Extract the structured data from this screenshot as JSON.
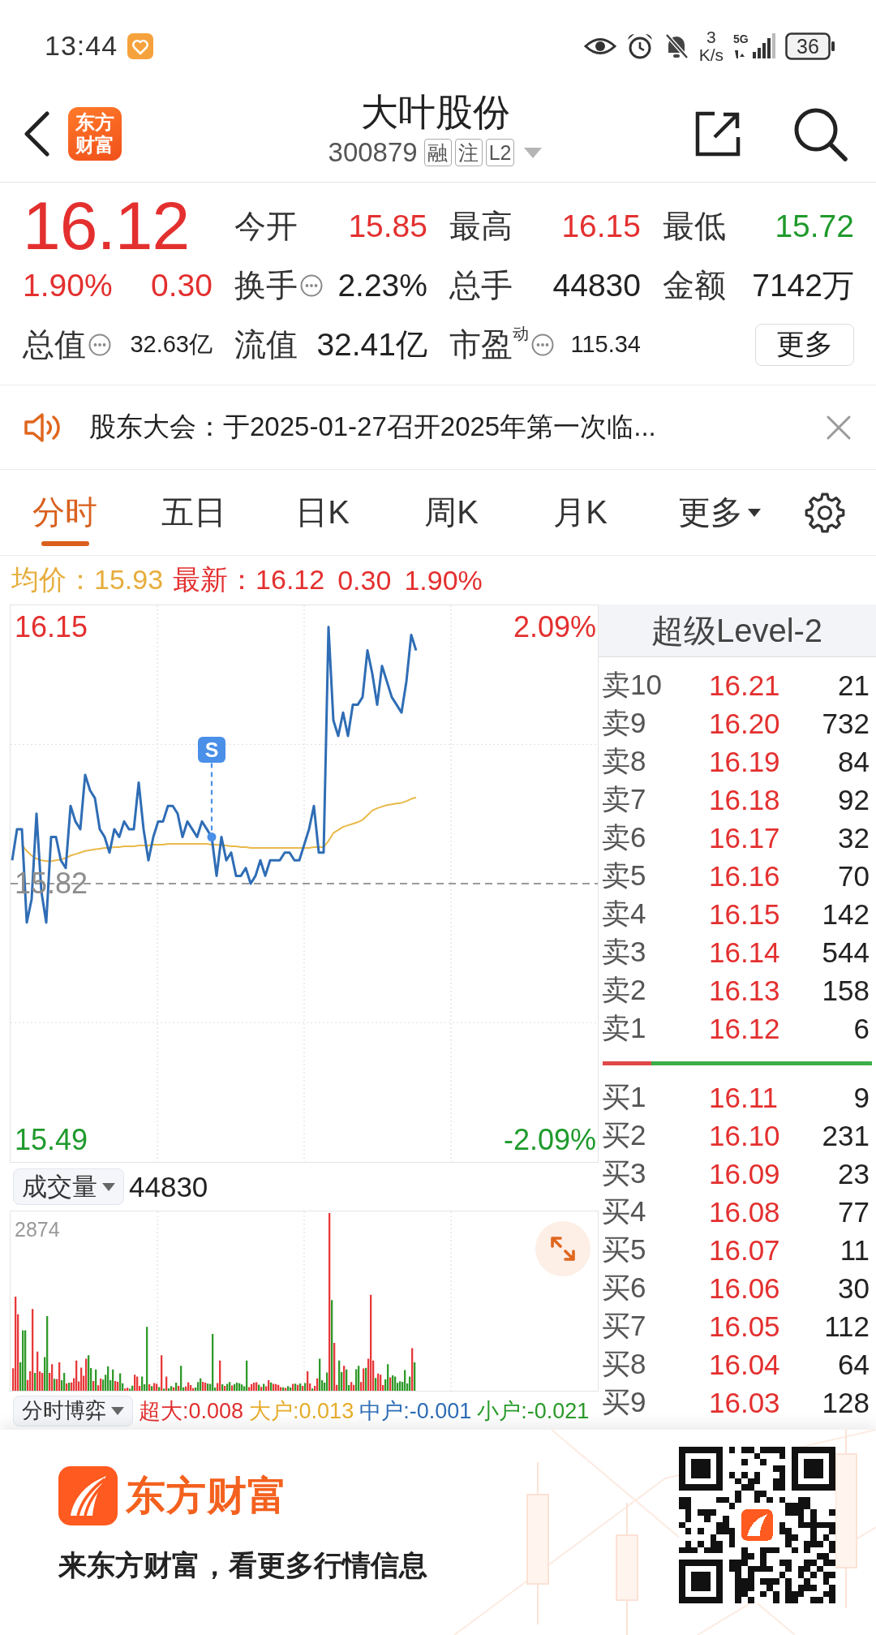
{
  "status_bar": {
    "time": "13:44",
    "net_speed": "3",
    "net_unit": "K/s",
    "network": "5G",
    "battery": "36"
  },
  "header": {
    "logo": "东方财富",
    "title": "大叶股份",
    "code": "300879",
    "tags": [
      "融",
      "注",
      "L2"
    ]
  },
  "quote": {
    "price": "16.12",
    "change_pct": "1.90%",
    "change": "0.30",
    "color": "#e3302f",
    "stats": [
      {
        "label": "今开",
        "value": "15.85",
        "color": "#e3302f",
        "info": false,
        "kind": "normal"
      },
      {
        "label": "最高",
        "value": "16.15",
        "color": "#e3302f",
        "info": false,
        "kind": "normal"
      },
      {
        "label": "最低",
        "value": "15.72",
        "color": "#1f9a2c",
        "info": false,
        "kind": "normal"
      },
      {
        "label": "换手",
        "value": "2.23%",
        "color": "#222222",
        "info": true,
        "kind": "normal"
      },
      {
        "label": "总手",
        "value": "44830",
        "color": "#222222",
        "info": false,
        "kind": "normal"
      },
      {
        "label": "金额",
        "value": "7142万",
        "color": "#222222",
        "info": false,
        "kind": "normal"
      },
      {
        "label": "总值",
        "value": "32.63亿",
        "color": "#222222",
        "info": true,
        "kind": "small"
      },
      {
        "label": "流值",
        "value": "32.41亿",
        "color": "#222222",
        "info": false,
        "kind": "normal"
      },
      {
        "label": "市盈$^{动}$",
        "value": "115.34",
        "color": "#222222",
        "info": true,
        "kind": "small"
      }
    ],
    "more_button": "更多"
  },
  "notice": {
    "text": "股东大会：于2025-01-27召开2025年第一次临..."
  },
  "tabs": [
    {
      "label": "分时",
      "selected": true,
      "dropdown": false
    },
    {
      "label": "五日",
      "selected": false,
      "dropdown": false
    },
    {
      "label": "日K",
      "selected": false,
      "dropdown": false
    },
    {
      "label": "周K",
      "selected": false,
      "dropdown": false
    },
    {
      "label": "月K",
      "selected": false,
      "dropdown": false
    },
    {
      "label": "更多",
      "selected": false,
      "dropdown": true
    }
  ],
  "summary": [
    {
      "text": "均价：15.93",
      "color": "#e6ad3c"
    },
    {
      "text": "最新：16.12",
      "color": "#e3302f"
    },
    {
      "text": "0.30",
      "color": "#e3302f"
    },
    {
      "text": "1.90%",
      "color": "#e3302f"
    }
  ],
  "price_chart": {
    "chart_data": {
      "type": "line",
      "categories": [
        null,
        null,
        null,
        null,
        null,
        null,
        null,
        null,
        null,
        null,
        null,
        null,
        null,
        null,
        null,
        null,
        null,
        null,
        null,
        null,
        null,
        null,
        null,
        null,
        null,
        null,
        null,
        null,
        null,
        null,
        null,
        null,
        null,
        null,
        null,
        null,
        null,
        null,
        null,
        null,
        null,
        null,
        null,
        null,
        null,
        null,
        null,
        null,
        null,
        null,
        null,
        null,
        null,
        null,
        null,
        null,
        null,
        null,
        null,
        null,
        null,
        null,
        null,
        null,
        null,
        null,
        null,
        null,
        null,
        null,
        null,
        null,
        null,
        null,
        null,
        null,
        null,
        null,
        null,
        null,
        null,
        null,
        null,
        null,
        null,
        null,
        null,
        null,
        null,
        null,
        null,
        null,
        null,
        null,
        null,
        null,
        null,
        null,
        null,
        null,
        null,
        null,
        null,
        null,
        null,
        null,
        null,
        null,
        null,
        null,
        null,
        null,
        null,
        null,
        null,
        null,
        null,
        null,
        null,
        null,
        null
      ],
      "ylim": [
        15.462,
        16.178
      ],
      "yticks": [
        {
          "value": 16.15,
          "label": "16.15"
        },
        {
          "value": 15.82,
          "label": "15.82"
        },
        {
          "value": 15.49,
          "label": "15.49"
        }
      ],
      "y2lim": [
        -2.269,
        2.269
      ],
      "y2ticks": [
        {
          "value": 2.09,
          "label": "2.09%"
        },
        {
          "value": -2.09,
          "label": "-2.09%"
        }
      ],
      "ref_lines": [
        {
          "axis": "y",
          "value": 15.82
        }
      ],
      "series": [
        {
          "color": "#2f6db5",
          "values": [
            15.85,
            15.89,
            15.89,
            15.77,
            15.8,
            15.91,
            15.81,
            15.77,
            15.88,
            15.88,
            15.85,
            15.84,
            15.92,
            15.9,
            15.89,
            15.96,
            15.94,
            15.93,
            15.89,
            15.88,
            15.86,
            15.89,
            15.88,
            15.9,
            15.89,
            15.89,
            15.95,
            15.89,
            15.85,
            15.88,
            15.9,
            15.9,
            15.92,
            15.92,
            15.91,
            15.88,
            15.9,
            15.89,
            15.88,
            15.9,
            15.89,
            15.88,
            15.83,
            15.88,
            15.85,
            15.86,
            15.83,
            15.83,
            15.84,
            15.82,
            15.83,
            15.85,
            15.83,
            15.85,
            15.85,
            15.85,
            15.86,
            15.86,
            15.85,
            15.85,
            15.87,
            15.89,
            15.92,
            15.86,
            15.86,
            16.15,
            16.03,
            16.01,
            16.04,
            16.01,
            16.05,
            16.05,
            16.06,
            16.12,
            16.09,
            16.05,
            16.1,
            16.08,
            16.06,
            16.05,
            16.04,
            16.08,
            16.14,
            16.12,
            null,
            null,
            null,
            null,
            null,
            null,
            null,
            null,
            null,
            null,
            null,
            null,
            null,
            null,
            null,
            null,
            null,
            null,
            null,
            null,
            null,
            null,
            null,
            null,
            null,
            null,
            null,
            null,
            null,
            null,
            null,
            null,
            null,
            null,
            null,
            null,
            null
          ]
        },
        {
          "color": "#e9b949",
          "values": [
            null,
            null,
            15.87,
            15.862,
            15.856,
            15.852,
            15.85,
            15.849,
            15.849,
            15.85,
            15.851,
            15.853,
            15.856,
            15.858,
            15.86,
            15.862,
            15.863,
            15.864,
            15.865,
            15.866,
            15.866,
            15.867,
            15.867,
            15.868,
            15.868,
            15.868,
            15.869,
            15.869,
            15.869,
            15.87,
            15.87,
            15.87,
            15.871,
            15.871,
            15.871,
            15.871,
            15.871,
            15.871,
            15.871,
            15.871,
            15.871,
            15.87,
            15.87,
            15.869,
            15.869,
            15.868,
            15.868,
            15.867,
            15.867,
            15.866,
            15.866,
            15.866,
            15.866,
            15.866,
            15.866,
            15.866,
            15.866,
            15.866,
            15.866,
            15.866,
            15.866,
            15.866,
            15.867,
            15.867,
            15.867,
            15.875,
            15.885,
            15.889,
            15.893,
            15.895,
            15.897,
            15.899,
            15.902,
            15.908,
            15.914,
            15.917,
            15.919,
            15.921,
            15.922,
            15.923,
            15.924,
            15.926,
            15.929,
            15.931,
            null,
            null,
            null,
            null,
            null,
            null,
            null,
            null,
            null,
            null,
            null,
            null,
            null,
            null,
            null,
            null,
            null,
            null,
            null,
            null,
            null,
            null,
            null,
            null,
            null,
            null,
            null,
            null,
            null,
            null,
            null,
            null,
            null,
            null,
            null,
            null,
            null
          ]
        },
        {
          "name": "S",
          "color": "#4a8fe8",
          "marker": "circle",
          "values": [
            null,
            null,
            null,
            null,
            null,
            null,
            null,
            null,
            null,
            null,
            null,
            null,
            null,
            null,
            null,
            null,
            null,
            null,
            null,
            null,
            null,
            null,
            null,
            null,
            null,
            null,
            null,
            null,
            null,
            null,
            null,
            null,
            null,
            null,
            null,
            null,
            null,
            null,
            null,
            null,
            null,
            15.88,
            null,
            null,
            null,
            null,
            null,
            null,
            null,
            null,
            null,
            null,
            null,
            null,
            null,
            null,
            null,
            null,
            null,
            null,
            null,
            null,
            null,
            null,
            null,
            null,
            null,
            null,
            null,
            null,
            null,
            null,
            null,
            null,
            null,
            null,
            null,
            null,
            null,
            null,
            null,
            null,
            null,
            null,
            null,
            null,
            null,
            null,
            null,
            null,
            null,
            null,
            null,
            null,
            null,
            null,
            null,
            null,
            null,
            null,
            null,
            null,
            null,
            null,
            null,
            null,
            null,
            null,
            null,
            null,
            null,
            null,
            null,
            null,
            null,
            null,
            null,
            null,
            null,
            null,
            null
          ]
        }
      ]
    }
  },
  "volume": {
    "selector": "成交量",
    "total": "44830",
    "max_label": "2874"
  },
  "flow_strip": {
    "selector": "分时博弈",
    "items": [
      {
        "text": "超大:0.008",
        "color": "#e0302f"
      },
      {
        "text": "大户:0.013",
        "color": "#e6ad2c"
      },
      {
        "text": "中户:-0.001",
        "color": "#2f6db5"
      },
      {
        "text": "小户:-0.021",
        "color": "#2a9a2a"
      }
    ]
  },
  "order_book": {
    "title": "超级Level-2",
    "asks": [
      {
        "label": "卖10",
        "price": "16.21",
        "volume": "21"
      },
      {
        "label": "卖9",
        "price": "16.20",
        "volume": "732"
      },
      {
        "label": "卖8",
        "price": "16.19",
        "volume": "84"
      },
      {
        "label": "卖7",
        "price": "16.18",
        "volume": "92"
      },
      {
        "label": "卖6",
        "price": "16.17",
        "volume": "32"
      },
      {
        "label": "卖5",
        "price": "16.16",
        "volume": "70"
      },
      {
        "label": "卖4",
        "price": "16.15",
        "volume": "142"
      },
      {
        "label": "卖3",
        "price": "16.14",
        "volume": "544"
      },
      {
        "label": "卖2",
        "price": "16.13",
        "volume": "158"
      },
      {
        "label": "卖1",
        "price": "16.12",
        "volume": "6"
      }
    ],
    "ratio_bar": {
      "level": 0.18
    },
    "bids": [
      {
        "label": "买1",
        "price": "16.11",
        "volume": "9"
      },
      {
        "label": "买2",
        "price": "16.10",
        "volume": "231"
      },
      {
        "label": "买3",
        "price": "16.09",
        "volume": "23"
      },
      {
        "label": "买4",
        "price": "16.08",
        "volume": "77"
      },
      {
        "label": "买5",
        "price": "16.07",
        "volume": "11"
      },
      {
        "label": "买6",
        "price": "16.06",
        "volume": "30"
      },
      {
        "label": "买7",
        "price": "16.05",
        "volume": "112"
      },
      {
        "label": "买8",
        "price": "16.04",
        "volume": "64"
      },
      {
        "label": "买9",
        "price": "16.03",
        "volume": "128"
      }
    ]
  },
  "banner": {
    "brand": "东方财富",
    "slogan": "来东方财富，看更多行情信息"
  }
}
